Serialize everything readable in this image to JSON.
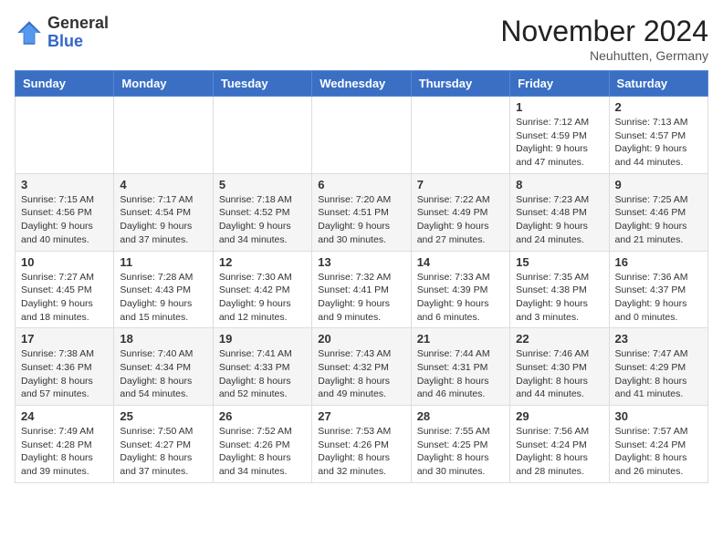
{
  "header": {
    "logo_general": "General",
    "logo_blue": "Blue",
    "month_title": "November 2024",
    "location": "Neuhutten, Germany"
  },
  "weekdays": [
    "Sunday",
    "Monday",
    "Tuesday",
    "Wednesday",
    "Thursday",
    "Friday",
    "Saturday"
  ],
  "weeks": [
    [
      {
        "day": "",
        "info": ""
      },
      {
        "day": "",
        "info": ""
      },
      {
        "day": "",
        "info": ""
      },
      {
        "day": "",
        "info": ""
      },
      {
        "day": "",
        "info": ""
      },
      {
        "day": "1",
        "info": "Sunrise: 7:12 AM\nSunset: 4:59 PM\nDaylight: 9 hours\nand 47 minutes."
      },
      {
        "day": "2",
        "info": "Sunrise: 7:13 AM\nSunset: 4:57 PM\nDaylight: 9 hours\nand 44 minutes."
      }
    ],
    [
      {
        "day": "3",
        "info": "Sunrise: 7:15 AM\nSunset: 4:56 PM\nDaylight: 9 hours\nand 40 minutes."
      },
      {
        "day": "4",
        "info": "Sunrise: 7:17 AM\nSunset: 4:54 PM\nDaylight: 9 hours\nand 37 minutes."
      },
      {
        "day": "5",
        "info": "Sunrise: 7:18 AM\nSunset: 4:52 PM\nDaylight: 9 hours\nand 34 minutes."
      },
      {
        "day": "6",
        "info": "Sunrise: 7:20 AM\nSunset: 4:51 PM\nDaylight: 9 hours\nand 30 minutes."
      },
      {
        "day": "7",
        "info": "Sunrise: 7:22 AM\nSunset: 4:49 PM\nDaylight: 9 hours\nand 27 minutes."
      },
      {
        "day": "8",
        "info": "Sunrise: 7:23 AM\nSunset: 4:48 PM\nDaylight: 9 hours\nand 24 minutes."
      },
      {
        "day": "9",
        "info": "Sunrise: 7:25 AM\nSunset: 4:46 PM\nDaylight: 9 hours\nand 21 minutes."
      }
    ],
    [
      {
        "day": "10",
        "info": "Sunrise: 7:27 AM\nSunset: 4:45 PM\nDaylight: 9 hours\nand 18 minutes."
      },
      {
        "day": "11",
        "info": "Sunrise: 7:28 AM\nSunset: 4:43 PM\nDaylight: 9 hours\nand 15 minutes."
      },
      {
        "day": "12",
        "info": "Sunrise: 7:30 AM\nSunset: 4:42 PM\nDaylight: 9 hours\nand 12 minutes."
      },
      {
        "day": "13",
        "info": "Sunrise: 7:32 AM\nSunset: 4:41 PM\nDaylight: 9 hours\nand 9 minutes."
      },
      {
        "day": "14",
        "info": "Sunrise: 7:33 AM\nSunset: 4:39 PM\nDaylight: 9 hours\nand 6 minutes."
      },
      {
        "day": "15",
        "info": "Sunrise: 7:35 AM\nSunset: 4:38 PM\nDaylight: 9 hours\nand 3 minutes."
      },
      {
        "day": "16",
        "info": "Sunrise: 7:36 AM\nSunset: 4:37 PM\nDaylight: 9 hours\nand 0 minutes."
      }
    ],
    [
      {
        "day": "17",
        "info": "Sunrise: 7:38 AM\nSunset: 4:36 PM\nDaylight: 8 hours\nand 57 minutes."
      },
      {
        "day": "18",
        "info": "Sunrise: 7:40 AM\nSunset: 4:34 PM\nDaylight: 8 hours\nand 54 minutes."
      },
      {
        "day": "19",
        "info": "Sunrise: 7:41 AM\nSunset: 4:33 PM\nDaylight: 8 hours\nand 52 minutes."
      },
      {
        "day": "20",
        "info": "Sunrise: 7:43 AM\nSunset: 4:32 PM\nDaylight: 8 hours\nand 49 minutes."
      },
      {
        "day": "21",
        "info": "Sunrise: 7:44 AM\nSunset: 4:31 PM\nDaylight: 8 hours\nand 46 minutes."
      },
      {
        "day": "22",
        "info": "Sunrise: 7:46 AM\nSunset: 4:30 PM\nDaylight: 8 hours\nand 44 minutes."
      },
      {
        "day": "23",
        "info": "Sunrise: 7:47 AM\nSunset: 4:29 PM\nDaylight: 8 hours\nand 41 minutes."
      }
    ],
    [
      {
        "day": "24",
        "info": "Sunrise: 7:49 AM\nSunset: 4:28 PM\nDaylight: 8 hours\nand 39 minutes."
      },
      {
        "day": "25",
        "info": "Sunrise: 7:50 AM\nSunset: 4:27 PM\nDaylight: 8 hours\nand 37 minutes."
      },
      {
        "day": "26",
        "info": "Sunrise: 7:52 AM\nSunset: 4:26 PM\nDaylight: 8 hours\nand 34 minutes."
      },
      {
        "day": "27",
        "info": "Sunrise: 7:53 AM\nSunset: 4:26 PM\nDaylight: 8 hours\nand 32 minutes."
      },
      {
        "day": "28",
        "info": "Sunrise: 7:55 AM\nSunset: 4:25 PM\nDaylight: 8 hours\nand 30 minutes."
      },
      {
        "day": "29",
        "info": "Sunrise: 7:56 AM\nSunset: 4:24 PM\nDaylight: 8 hours\nand 28 minutes."
      },
      {
        "day": "30",
        "info": "Sunrise: 7:57 AM\nSunset: 4:24 PM\nDaylight: 8 hours\nand 26 minutes."
      }
    ]
  ]
}
